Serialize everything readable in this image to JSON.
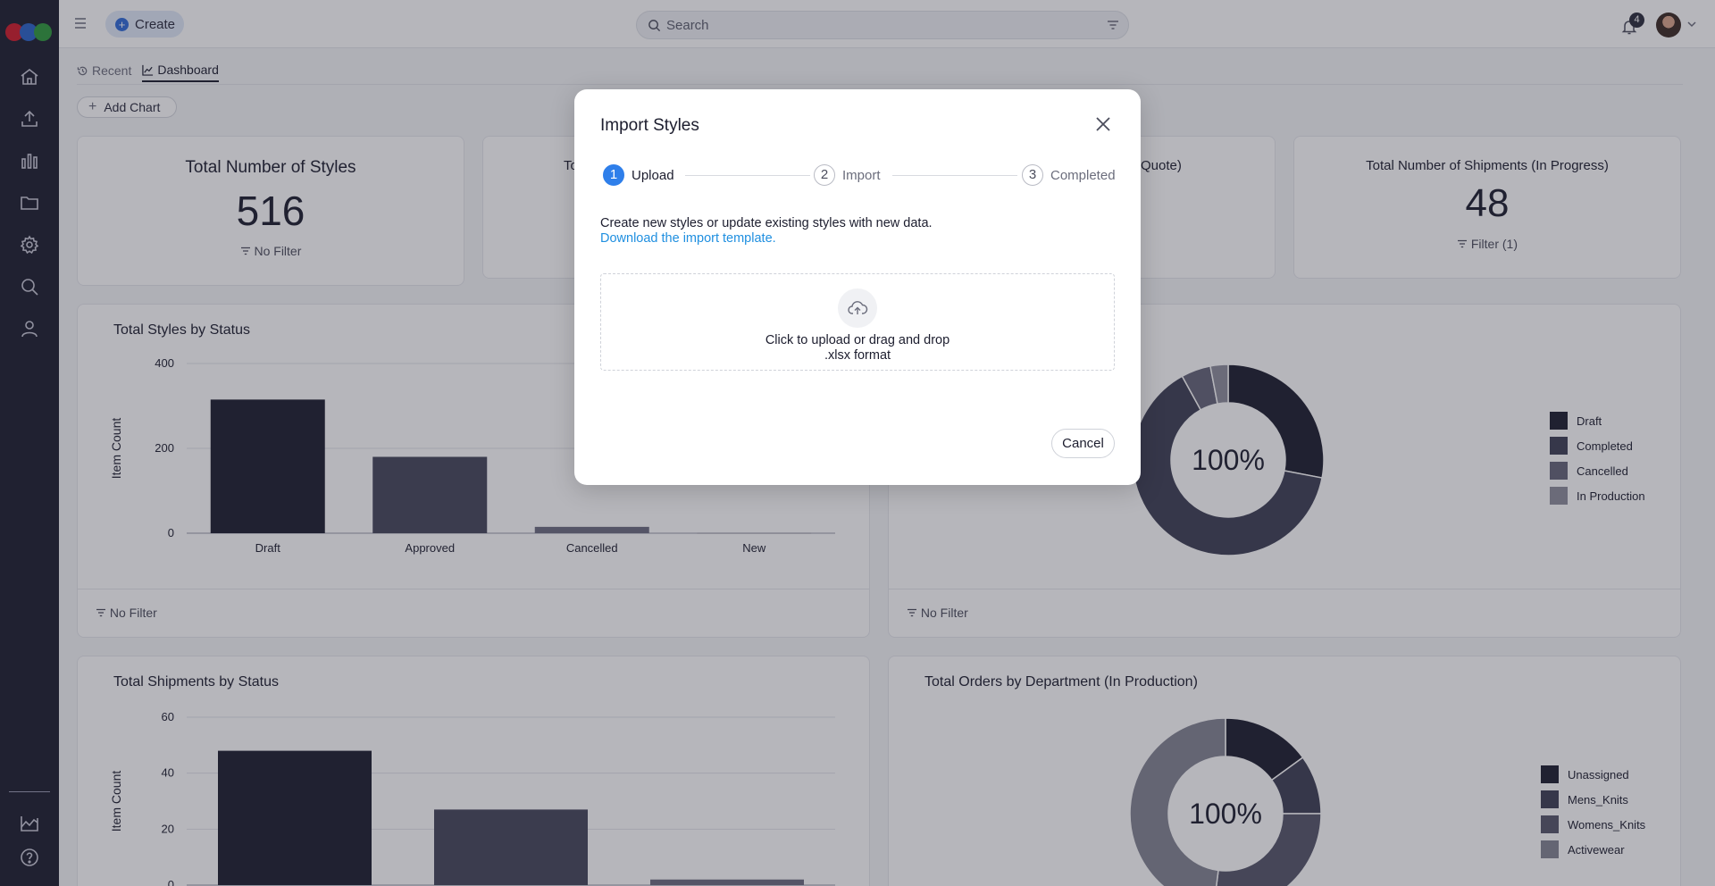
{
  "topbar": {
    "create_label": "Create",
    "search_placeholder": "Search",
    "notification_count": "4"
  },
  "tabs": [
    {
      "label": "Recent",
      "icon": "history-icon",
      "active": false
    },
    {
      "label": "Dashboard",
      "icon": "chart-line-icon",
      "active": true
    }
  ],
  "toolbar": {
    "add_chart_label": "Add Chart"
  },
  "kpis": [
    {
      "title": "Total Number of Styles",
      "value": "516",
      "filter": "No Filter"
    },
    {
      "title": "To",
      "value": "",
      "filter": ""
    },
    {
      "title": "Quote)",
      "value": "",
      "filter": ""
    },
    {
      "title": "Total Number of Shipments (In Progress)",
      "value": "48",
      "filter": "Filter (1)"
    }
  ],
  "charts": {
    "styles_by_status": {
      "title": "Total Styles by Status",
      "footer": "No Filter"
    },
    "status_donut": {
      "center": "100%",
      "footer": "No Filter"
    },
    "shipments_by_status": {
      "title": "Total Shipments by Status"
    },
    "orders_by_department": {
      "title": "Total Orders by Department (In Production)",
      "center": "100%"
    }
  },
  "chart_data": [
    {
      "type": "bar",
      "title": "Total Styles by Status",
      "ylabel": "Item Count",
      "categories": [
        "Draft",
        "Approved",
        "Cancelled",
        "New"
      ],
      "values": [
        315,
        180,
        15,
        1
      ],
      "ylim": [
        0,
        400
      ],
      "yticks": [
        0,
        200,
        400
      ],
      "colors": [
        "#1c1d2e",
        "#45465a",
        "#6c6d80",
        "#8c8d9c"
      ]
    },
    {
      "type": "pie",
      "legend": [
        "Draft",
        "Completed",
        "Cancelled",
        "In Production"
      ],
      "values": [
        28,
        64,
        5,
        3
      ],
      "colors": [
        "#1c1d2e",
        "#3e3f54",
        "#646578",
        "#8d8e9c"
      ]
    },
    {
      "type": "bar",
      "title": "Total Shipments by Status",
      "ylabel": "Item Count",
      "categories": [
        "",
        "",
        ""
      ],
      "values": [
        48,
        27,
        2
      ],
      "ylim": [
        0,
        60
      ],
      "yticks": [
        0,
        20,
        40,
        60
      ],
      "colors": [
        "#1c1d2e",
        "#45465a",
        "#6c6d80"
      ]
    },
    {
      "type": "pie",
      "legend": [
        "Unassigned",
        "Mens_Knits",
        "Womens_Knits",
        "Activewear"
      ],
      "values": [
        15,
        10,
        27,
        48
      ],
      "colors": [
        "#1c1d2e",
        "#3e3f54",
        "#55566a",
        "#838492"
      ]
    }
  ],
  "modal": {
    "title": "Import Styles",
    "steps": [
      {
        "num": "1",
        "label": "Upload"
      },
      {
        "num": "2",
        "label": "Import"
      },
      {
        "num": "3",
        "label": "Completed"
      }
    ],
    "description": "Create new styles or update existing styles with new data.",
    "template_link": "Download the import template.",
    "upload_text": "Click to upload or drag and drop",
    "upload_format": ".xlsx format",
    "cancel_label": "Cancel"
  }
}
